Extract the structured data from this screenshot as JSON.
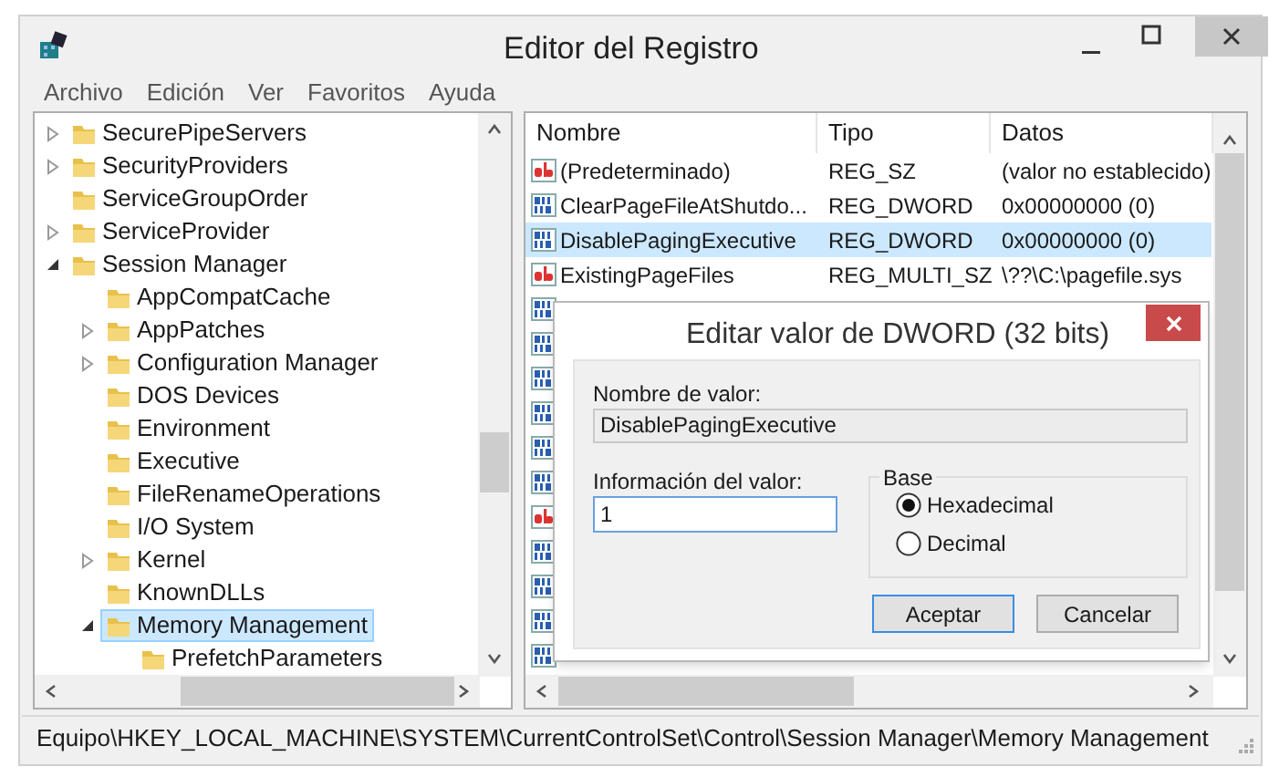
{
  "window": {
    "title": "Editor del Registro"
  },
  "menu": [
    "Archivo",
    "Edición",
    "Ver",
    "Favoritos",
    "Ayuda"
  ],
  "tree": [
    {
      "label": "SecurePipeServers",
      "expanded": false,
      "selected": false
    },
    {
      "label": "SecurityProviders",
      "expanded": false,
      "selected": false
    },
    {
      "label": "ServiceGroupOrder",
      "selected": false
    },
    {
      "label": "ServiceProvider",
      "expanded": false,
      "selected": false
    },
    {
      "label": "Session Manager",
      "expanded": true,
      "selected": false,
      "children": [
        {
          "label": "AppCompatCache",
          "selected": false
        },
        {
          "label": "AppPatches",
          "expanded": false,
          "selected": false
        },
        {
          "label": "Configuration Manager",
          "expanded": false,
          "selected": false
        },
        {
          "label": "DOS Devices",
          "selected": false
        },
        {
          "label": "Environment",
          "selected": false
        },
        {
          "label": "Executive",
          "selected": false
        },
        {
          "label": "FileRenameOperations",
          "selected": false
        },
        {
          "label": "I/O System",
          "selected": false
        },
        {
          "label": "Kernel",
          "expanded": false,
          "selected": false
        },
        {
          "label": "KnownDLLs",
          "selected": false
        },
        {
          "label": "Memory Management",
          "expanded": true,
          "selected": true,
          "children": [
            {
              "label": "PrefetchParameters",
              "selected": false
            }
          ]
        }
      ]
    }
  ],
  "values": {
    "columns": [
      "Nombre",
      "Tipo",
      "Datos"
    ],
    "rows": [
      {
        "kind": "string",
        "name": "(Predeterminado)",
        "type": "REG_SZ",
        "data": "(valor no establecido)",
        "selected": false
      },
      {
        "kind": "dword",
        "name": "ClearPageFileAtShutdo...",
        "type": "REG_DWORD",
        "data": "0x00000000 (0)",
        "selected": false
      },
      {
        "kind": "dword",
        "name": "DisablePagingExecutive",
        "type": "REG_DWORD",
        "data": "0x00000000 (0)",
        "selected": true
      },
      {
        "kind": "string",
        "name": "ExistingPageFiles",
        "type": "REG_MULTI_SZ",
        "data": "\\??\\C:\\pagefile.sys",
        "selected": false
      }
    ],
    "covered_rows": [
      {
        "kind": "dword"
      },
      {
        "kind": "dword"
      },
      {
        "kind": "dword"
      },
      {
        "kind": "dword"
      },
      {
        "kind": "dword"
      },
      {
        "kind": "dword"
      },
      {
        "kind": "string"
      },
      {
        "kind": "dword"
      },
      {
        "kind": "dword"
      },
      {
        "kind": "dword"
      },
      {
        "kind": "dword"
      }
    ]
  },
  "dialog": {
    "title": "Editar valor de DWORD (32 bits)",
    "name_label": "Nombre de valor:",
    "name_value": "DisablePagingExecutive",
    "info_label": "Información del valor:",
    "info_value": "1",
    "base_label": "Base",
    "base_options": [
      {
        "label": "Hexadecimal",
        "selected": true
      },
      {
        "label": "Decimal",
        "selected": false
      }
    ],
    "buttons": [
      {
        "label": "Aceptar",
        "default": true
      },
      {
        "label": "Cancelar",
        "default": false
      }
    ]
  },
  "status_bar": "Equipo\\HKEY_LOCAL_MACHINE\\SYSTEM\\CurrentControlSet\\Control\\Session Manager\\Memory Management"
}
